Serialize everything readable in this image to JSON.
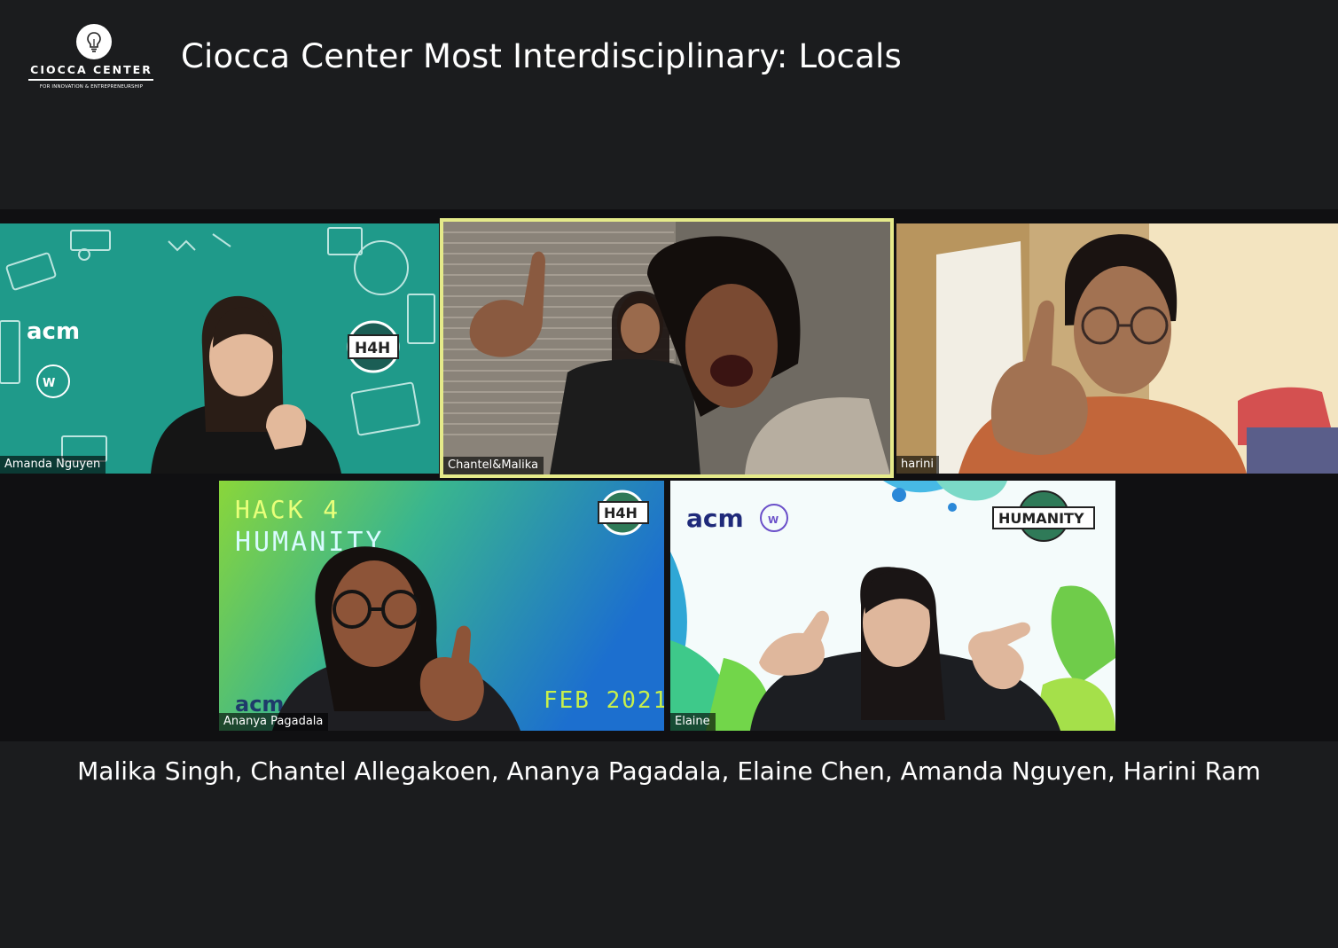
{
  "header": {
    "logo_name": "CIOCCA CENTER",
    "logo_subtitle": "FOR INNOVATION & ENTREPRENEURSHIP",
    "title": "Ciocca Center Most Interdisciplinary: Locals"
  },
  "gallery": {
    "tiles": [
      {
        "name": "Amanda Nguyen",
        "background": "teal-acm-h4h",
        "logo_text": "acm",
        "badge_text": "H4H",
        "active_speaker": false
      },
      {
        "name": "Chantel&Malika",
        "background": "bedroom-blinds",
        "active_speaker": true
      },
      {
        "name": "harini",
        "background": "bedroom-warm",
        "active_speaker": false
      },
      {
        "name": "Ananya Pagadala",
        "background": "green-blue-gradient",
        "banner_line1": "HACK 4",
        "banner_line2": "HUMANITY",
        "date_text": "FEB 2021",
        "badge_text": "H4H",
        "logo_text": "acm",
        "active_speaker": false
      },
      {
        "name": "Elaine",
        "background": "white-wave-pattern",
        "logo_text": "acm",
        "badge_text": "HUMANITY",
        "active_speaker": false
      }
    ],
    "highlight_color": "#e5ea8a"
  },
  "footer": {
    "names": "Malika Singh, Chantel Allegakoen, Ananya Pagadala, Elaine Chen, Amanda Nguyen, Harini Ram"
  }
}
